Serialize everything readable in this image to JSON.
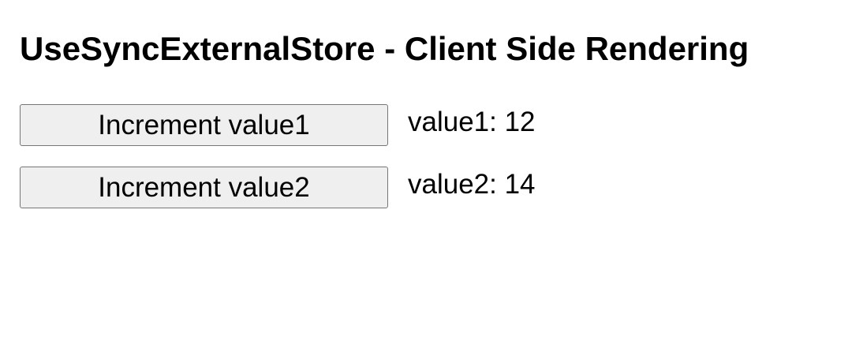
{
  "page": {
    "title": "UseSyncExternalStore - Client Side Rendering"
  },
  "counters": [
    {
      "button_label": "Increment value1",
      "value_text": "value1: 12"
    },
    {
      "button_label": "Increment value2",
      "value_text": "value2: 14"
    }
  ]
}
